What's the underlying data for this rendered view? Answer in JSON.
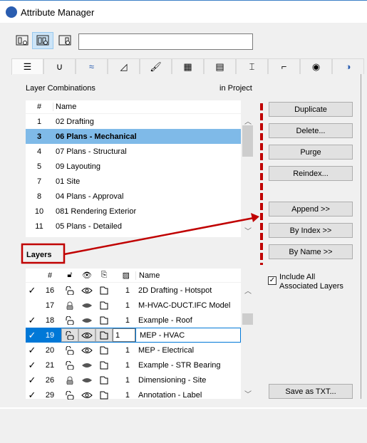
{
  "window": {
    "title": "Attribute Manager",
    "accent": "#0078d7"
  },
  "toolbar": {
    "buttons": [
      {
        "icon": "left-panel-search-icon"
      },
      {
        "icon": "both-panels-search-icon",
        "selected": true
      },
      {
        "icon": "right-panel-search-icon"
      }
    ],
    "search_value": ""
  },
  "tabs": [
    {
      "icon": "layers-icon",
      "active": true
    },
    {
      "icon": "pen-icon"
    },
    {
      "icon": "line-type-icon"
    },
    {
      "icon": "fill-icon"
    },
    {
      "icon": "surface-brush-icon"
    },
    {
      "icon": "building-material-icon"
    },
    {
      "icon": "composite-icon"
    },
    {
      "icon": "profile-icon"
    },
    {
      "icon": "zone-category-icon"
    },
    {
      "icon": "globe-icon"
    },
    {
      "icon": "more-icon"
    }
  ],
  "combinations": {
    "label": "Layer Combinations",
    "location": "in Project",
    "headers": {
      "num": "#",
      "name": "Name"
    },
    "rows": [
      {
        "num": "1",
        "name": "02 Drafting"
      },
      {
        "num": "3",
        "name": "06 Plans - Mechanical",
        "selected": true
      },
      {
        "num": "4",
        "name": "07 Plans - Structural"
      },
      {
        "num": "5",
        "name": "09 Layouting"
      },
      {
        "num": "7",
        "name": "01 Site"
      },
      {
        "num": "8",
        "name": "04 Plans - Approval"
      },
      {
        "num": "10",
        "name": "081 Rendering Exterior"
      },
      {
        "num": "11",
        "name": "05 Plans - Detailed"
      }
    ]
  },
  "buttons": {
    "duplicate": "Duplicate",
    "delete": "Delete...",
    "purge": "Purge",
    "reindex": "Reindex...",
    "append": "Append >>",
    "by_index": "By Index >>",
    "by_name": "By Name >>",
    "save_txt": "Save as TXT..."
  },
  "include_all": {
    "label": "Include All Associated Layers",
    "checked": true
  },
  "layers": {
    "label": "Layers",
    "headers": {
      "num": "#",
      "name": "Name"
    },
    "rows": [
      {
        "checked": true,
        "num": "16",
        "locked": false,
        "visible": true,
        "pen": "1",
        "name": "2D Drafting - Hotspot"
      },
      {
        "checked": false,
        "num": "17",
        "locked": true,
        "visible": false,
        "pen": "1",
        "name": "M-HVAC-DUCT.IFC Model"
      },
      {
        "checked": true,
        "num": "18",
        "locked": false,
        "visible": false,
        "pen": "1",
        "name": "Example - Roof"
      },
      {
        "checked": true,
        "num": "19",
        "locked": false,
        "visible": true,
        "pen": "1",
        "name": "MEP - HVAC",
        "selected": true
      },
      {
        "checked": true,
        "num": "20",
        "locked": false,
        "visible": true,
        "pen": "1",
        "name": "MEP - Electrical"
      },
      {
        "checked": true,
        "num": "21",
        "locked": false,
        "visible": false,
        "pen": "1",
        "name": "Example - STR Bearing"
      },
      {
        "checked": true,
        "num": "26",
        "locked": true,
        "visible": false,
        "pen": "1",
        "name": "Dimensioning - Site"
      },
      {
        "checked": true,
        "num": "29",
        "locked": false,
        "visible": true,
        "pen": "1",
        "name": "Annotation - Label"
      }
    ]
  },
  "annotation": {
    "color": "#c00000"
  }
}
